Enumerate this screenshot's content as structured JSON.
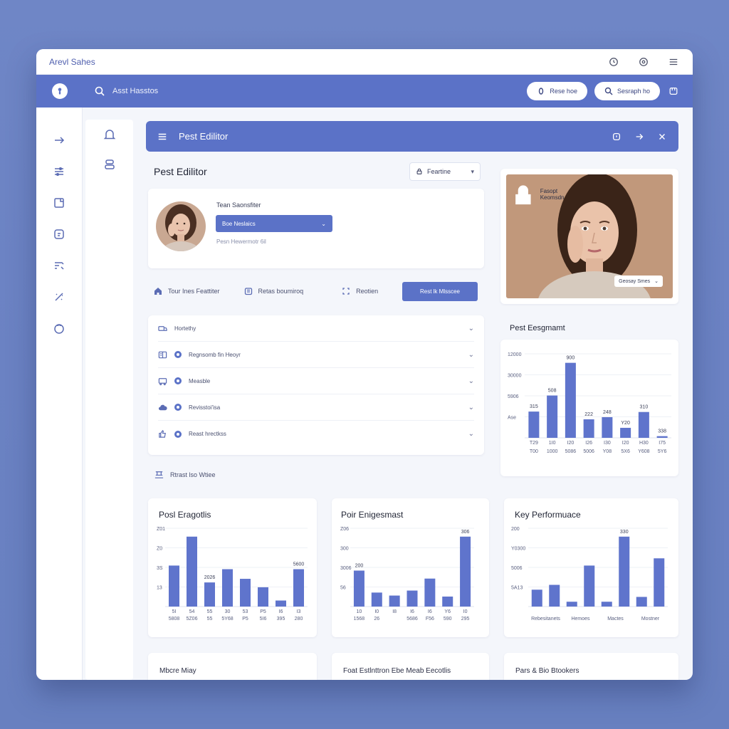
{
  "window": {
    "title": "Arevl Sahes"
  },
  "topbar": {
    "search_text": "Asst Hasstos",
    "pill_left": "Rese hoe",
    "pill_right": "Sesraph ho"
  },
  "panel": {
    "title": "Pest Edilitor"
  },
  "editor": {
    "heading": "Pest Edilitor",
    "dropdown": "Feartine",
    "profile": {
      "label": "Tean Saonsfiter",
      "select": "Boe Neslaics",
      "note": "Pesn Hewermotr 6il"
    },
    "actions": [
      "Tour Ines Feattiter",
      "Retas boumiroq",
      "Reotien"
    ],
    "primary_action": "Rest lk Mlsscee",
    "list": [
      "Hortethy",
      "Regnsomb fin Heoyr",
      "Measble",
      "Revisstoi'isa",
      "Reast hrectkss"
    ],
    "footer_link": "Rtrast lso Wtiee"
  },
  "photo": {
    "tag": "Fasopt Keomsdn",
    "pill": "Geosay Smes"
  },
  "colors": {
    "accent": "#5b72c7",
    "bar": "#5f74cc",
    "background": "#6f86c6"
  },
  "chart_data": [
    {
      "type": "bar",
      "title": "Pest Eesgmamt",
      "yticks": [
        "12000",
        "30000",
        "5906",
        "Ase"
      ],
      "categories": [
        "T00",
        "1000",
        "5086",
        "5006",
        "Y08",
        "5X6",
        "Y608",
        "5Y6"
      ],
      "values": [
        315,
        508,
        900,
        222,
        248,
        120,
        310,
        20
      ],
      "data_labels": [
        "315",
        "508",
        "900",
        "222",
        "248",
        "Y20",
        "310",
        "338"
      ],
      "bottom_labels": [
        "T29",
        "1I0",
        "I20",
        "I26",
        "I30",
        "I20",
        "H30",
        "I75"
      ]
    },
    {
      "type": "bar",
      "title": "Posl Eragotlis",
      "yticks": [
        "Z01",
        "Z0",
        "3S",
        "13"
      ],
      "categories": [
        "5808",
        "5Z06",
        "55",
        "5Y68",
        "P5",
        "5I6",
        "395",
        "280"
      ],
      "top_labels": [
        "5I",
        "54",
        "55",
        "30",
        "53",
        "P5",
        "I6",
        "I3"
      ],
      "values": [
        34,
        58,
        20,
        31,
        23,
        16,
        5,
        31
      ],
      "data_labels": [
        "",
        "",
        "2026",
        "",
        "",
        "",
        "",
        "5600"
      ]
    },
    {
      "type": "bar",
      "title": "Poir Enigesmast",
      "yticks": [
        "Z06",
        "300",
        "3006",
        "56"
      ],
      "categories": [
        "1568",
        "26",
        "",
        "5686",
        "F56",
        "590",
        "295"
      ],
      "top_labels": [
        "10",
        "I0",
        "I8",
        "I6",
        "I6",
        "Y6",
        "I0"
      ],
      "values": [
        36,
        14,
        11,
        16,
        28,
        10,
        70
      ],
      "data_labels": [
        "200",
        "",
        "",
        "",
        "",
        "",
        "306"
      ]
    },
    {
      "type": "bar",
      "title": "Key Performuace",
      "yticks": [
        "200",
        "Y0300",
        "5006",
        "5A13"
      ],
      "categories": [
        "Rebesitanets",
        "Hemoes",
        "Mactes",
        "Mostner"
      ],
      "top_labels": [
        "",
        "",
        "",
        "",
        "",
        "",
        "",
        ""
      ],
      "values": [
        14,
        18,
        4,
        34,
        4,
        58,
        8,
        40
      ],
      "data_labels": [
        "",
        "",
        "",
        "",
        "",
        "330",
        "",
        ""
      ]
    }
  ],
  "bottom_cards": [
    "Mbcre Miay",
    "Foat Estlnttron Ebe Meab Eecotlis",
    "Pars & Bio Btookers"
  ]
}
